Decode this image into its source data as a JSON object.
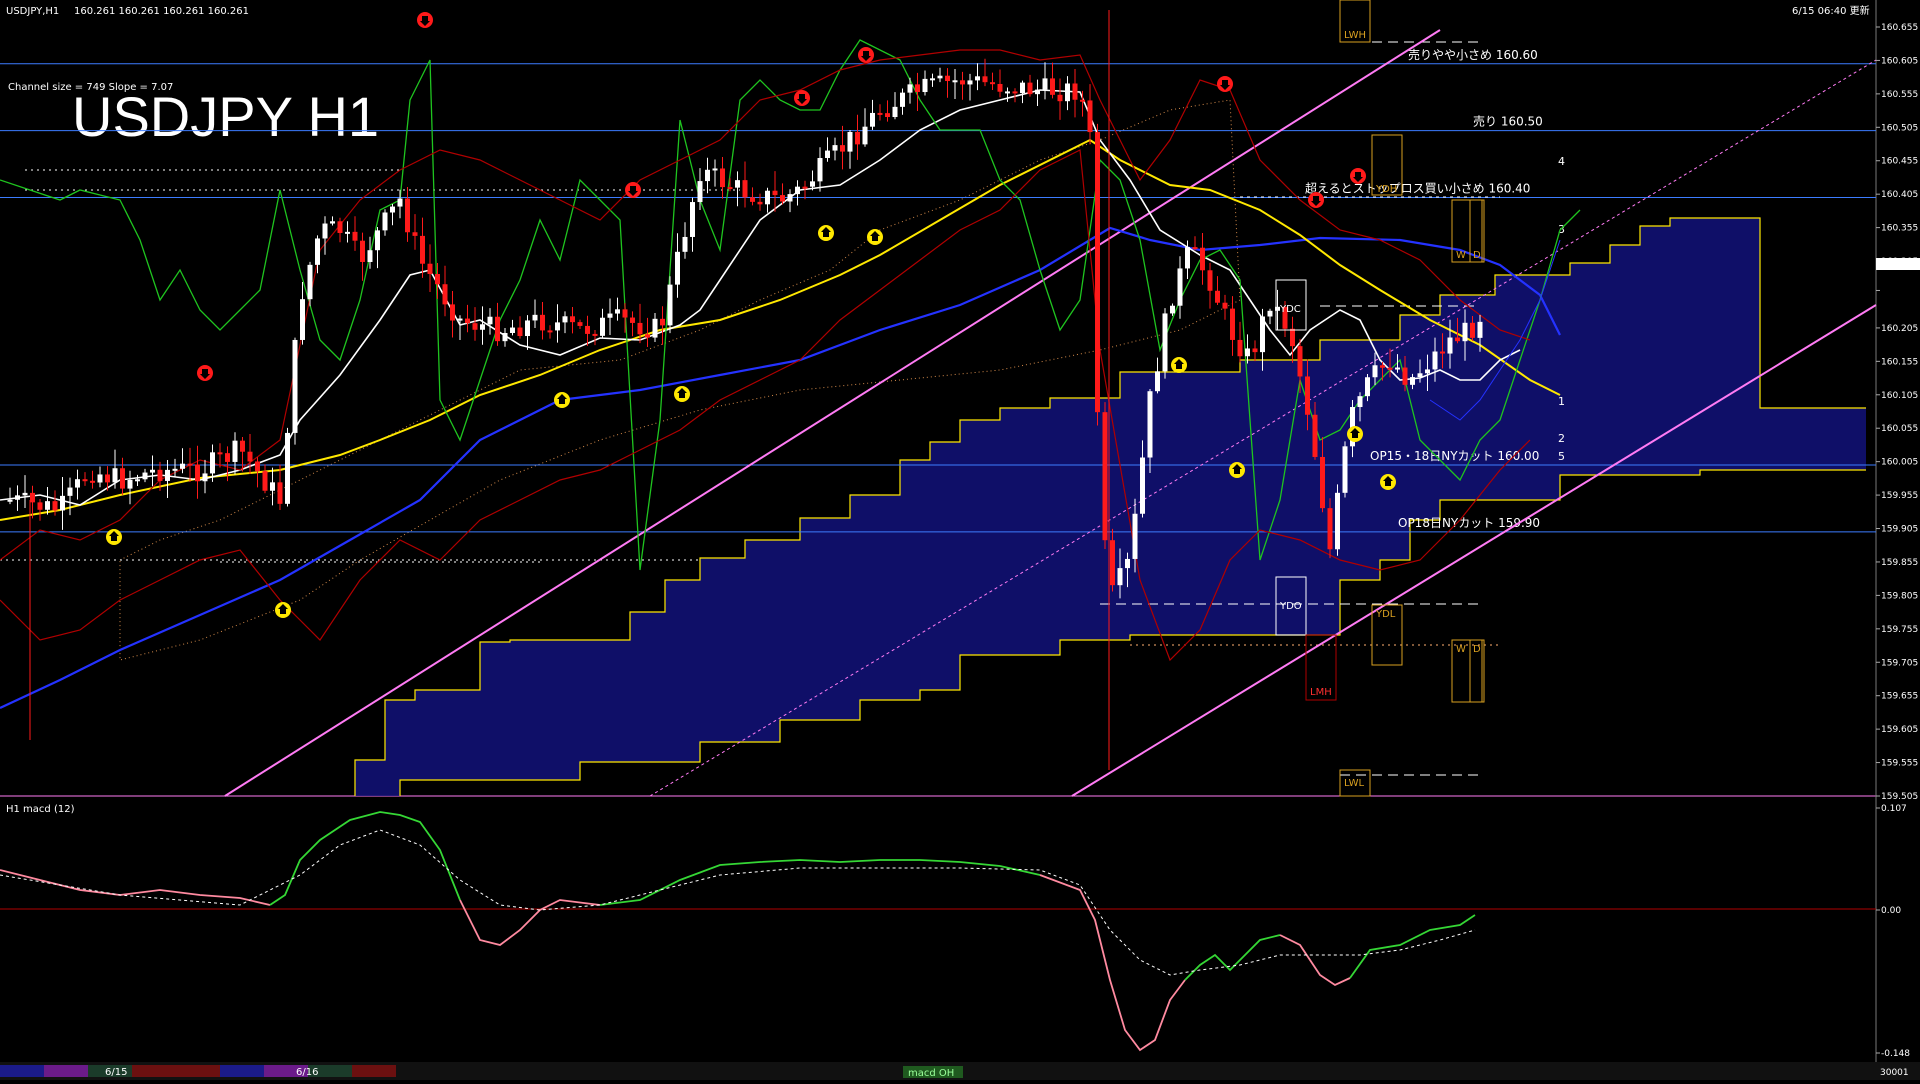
{
  "window": {
    "title": "USDJPY,H1",
    "ohlc": "160.261 160.261 160.261 160.261",
    "time_label": "6/15 06:40 更新"
  },
  "overlay": {
    "channel_info": "Channel size = 749 Slope = 7.07",
    "big_title": "USDJPY H1"
  },
  "levels": [
    {
      "label": "売りやや小さめ 160.60",
      "price": 160.6,
      "color": "#3c7cff"
    },
    {
      "label": "売り 160.50",
      "price": 160.5,
      "color": "#3c7cff"
    },
    {
      "label": "超えるとストップロス買い小さめ 160.40",
      "price": 160.4,
      "color": "#3c7cff"
    },
    {
      "label": "OP15・18日NYカット 160.00",
      "price": 160.0,
      "color": "#3c7cff"
    },
    {
      "label": "OP18日NYカット 159.90",
      "price": 159.9,
      "color": "#3c7cff"
    }
  ],
  "box_labels": [
    "LWH",
    "YDH",
    "YDC",
    "YDO",
    "YDL",
    "LMH",
    "LWL",
    "W",
    "D"
  ],
  "channel_numbers": [
    "1",
    "2",
    "3",
    "4",
    "5"
  ],
  "axis": {
    "ticks": [
      "160.655",
      "160.605",
      "160.555",
      "160.505",
      "160.455",
      "160.405",
      "160.355",
      "160.305",
      "160.261",
      "160.205",
      "160.155",
      "160.105",
      "160.055",
      "160.005",
      "159.955",
      "159.905",
      "159.855",
      "159.805",
      "159.755",
      "159.705",
      "159.655",
      "159.605",
      "159.555",
      "159.505"
    ],
    "macd_ticks": [
      "0.107",
      "0.00",
      "-0.148"
    ]
  },
  "macd": {
    "title": "H1  macd (12)",
    "line_color": "#35d735",
    "neg_color": "#ff8aa0",
    "signal_color": "#ffffff"
  },
  "bottom": {
    "dates": [
      "6/15",
      "6/16"
    ],
    "tab_label": "macd OH",
    "counter": "30001"
  },
  "colors": {
    "bull": "#ffffff",
    "bear": "#ff1a1a",
    "ma_yellow": "#ffe800",
    "ma_blue": "#2432ff",
    "ma_white": "#ffffff",
    "channel": "#ff7bf4",
    "cloud": "#12127a",
    "green_line": "#1fc41f",
    "bollinger": "#b00000"
  }
}
